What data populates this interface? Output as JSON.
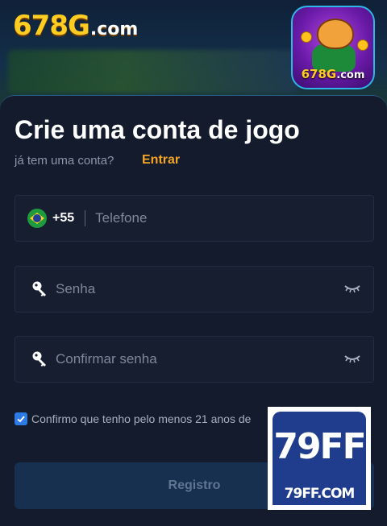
{
  "brand": {
    "logo_number": "678G",
    "logo_domain": ".com"
  },
  "app_icon": {
    "number": "678G",
    "domain": ".com"
  },
  "form": {
    "title": "Crie uma conta de jogo",
    "subtitle": "já tem uma conta?",
    "login_link": "Entrar",
    "phone": {
      "country_code": "+55",
      "placeholder": "Telefone"
    },
    "password": {
      "placeholder": "Senha"
    },
    "confirm_password": {
      "placeholder": "Confirmar senha"
    },
    "terms": {
      "checked": true,
      "text": "Confirmo que tenho pelo menos 21 anos de"
    },
    "register_label": "Registro"
  },
  "watermark": {
    "big": "79FF",
    "small": "79FF.COM"
  },
  "colors": {
    "accent": "#f5a623",
    "checkbox": "#2c7be5",
    "button_bg": "#17304f",
    "sheet_bg": "#131b2d"
  }
}
